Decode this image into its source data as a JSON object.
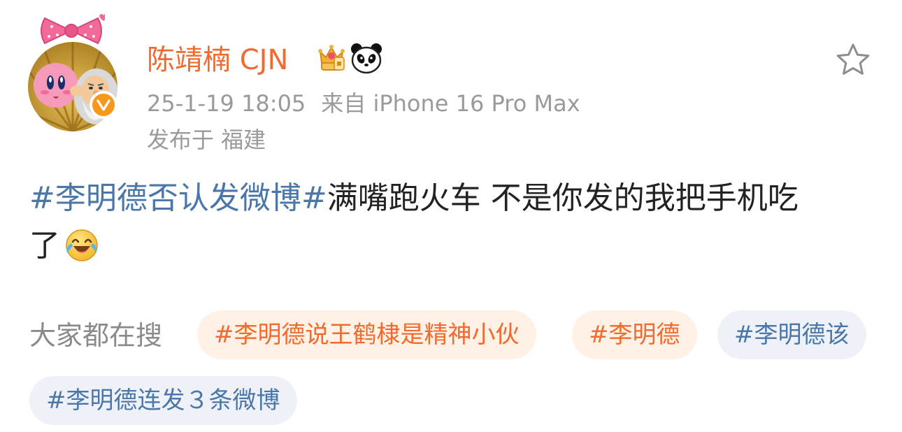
{
  "user": {
    "name": "陈靖楠 CJN",
    "avatar_icon": "cartoon-avatar",
    "verified_icon": "orange-v-badge",
    "badges": [
      "crown-member-icon",
      "panda-icon"
    ]
  },
  "meta": {
    "time": "25-1-19 18:05",
    "source": "来自 iPhone 16 Pro Max",
    "location": "发布于 福建"
  },
  "actions": {
    "favorite_icon": "star-outline-icon"
  },
  "post": {
    "hashtag": "#李明德否认发微博#",
    "text_line1": "满嘴跑火车 不是你发的我把手机吃",
    "text_line2": "了",
    "emoji": "laughing-crying-emoji"
  },
  "trending": {
    "label": "大家都在搜",
    "topics": [
      {
        "text": "#李明德说王鹤棣是精神小伙",
        "style": "hot"
      },
      {
        "text": "#李明德",
        "style": "hot"
      },
      {
        "text": "#李明德该",
        "style": "normal"
      },
      {
        "text": "#李明德连发３条微博",
        "style": "normal"
      }
    ]
  },
  "colors": {
    "name_orange": "#f26a2e",
    "link_blue": "#4a76a8",
    "meta_gray": "#9a9a9a",
    "hot_chip_bg": "#fff1e6",
    "normal_chip_bg": "#eef2f8",
    "verified_orange": "#f7981c"
  }
}
